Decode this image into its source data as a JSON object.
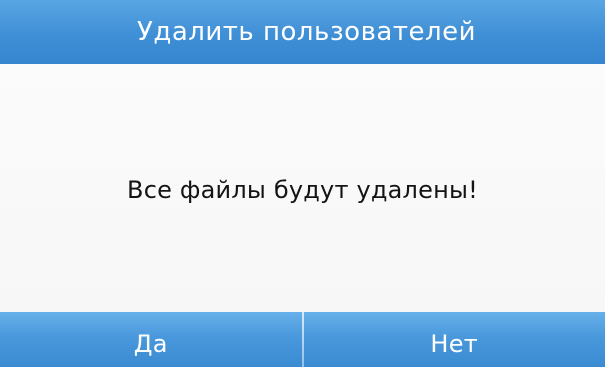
{
  "dialog": {
    "title": "Удалить пользователей",
    "message": "Все файлы будут удалены!",
    "buttons": {
      "yes_label": "Да",
      "no_label": "Нет"
    }
  },
  "colors": {
    "accent": "#3f8fd6",
    "background": "#f9f9f9",
    "text": "#141414"
  }
}
